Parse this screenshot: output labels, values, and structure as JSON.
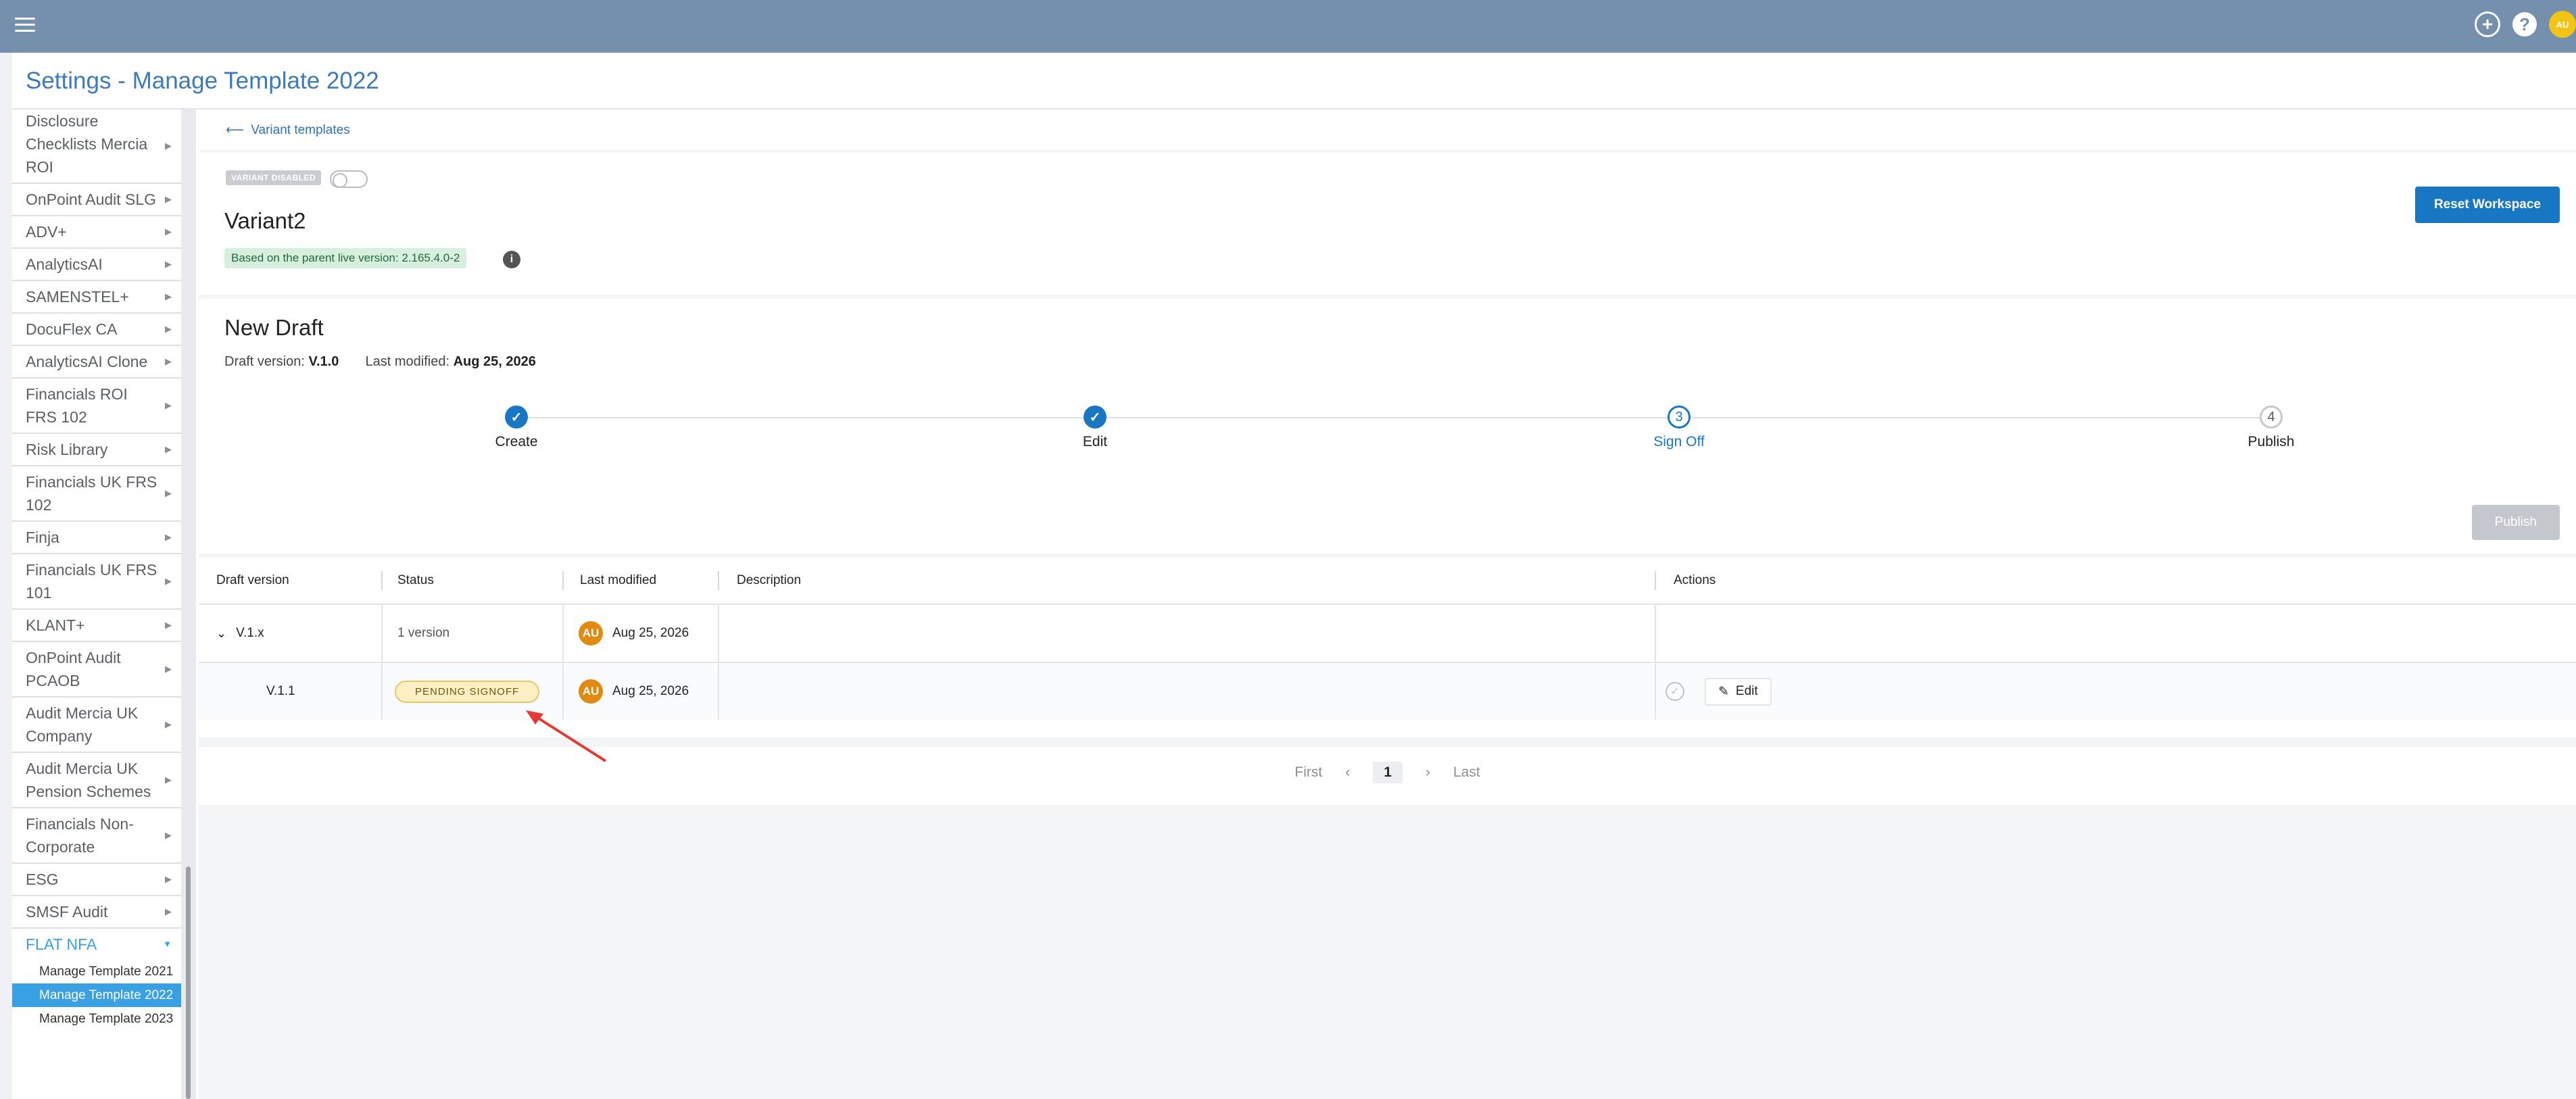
{
  "header": {
    "menu_icon": "hamburger-icon",
    "add_icon": "+",
    "help_icon": "?",
    "avatar_initials": "AU"
  },
  "page": {
    "title": "Settings - Manage Template 2022"
  },
  "sidebar": {
    "items": [
      {
        "label": "Disclosure Checklists Mercia ROI"
      },
      {
        "label": "OnPoint Audit SLG"
      },
      {
        "label": "ADV+"
      },
      {
        "label": "AnalyticsAI"
      },
      {
        "label": "SAMENSTEL+"
      },
      {
        "label": "DocuFlex CA"
      },
      {
        "label": "AnalyticsAI Clone"
      },
      {
        "label": "Financials ROI FRS 102"
      },
      {
        "label": "Risk Library"
      },
      {
        "label": "Financials UK FRS 102"
      },
      {
        "label": "Finja"
      },
      {
        "label": "Financials UK FRS 101"
      },
      {
        "label": "KLANT+"
      },
      {
        "label": "OnPoint Audit PCAOB"
      },
      {
        "label": "Audit Mercia UK Company"
      },
      {
        "label": "Audit Mercia UK Pension Schemes"
      },
      {
        "label": "Financials Non-Corporate"
      },
      {
        "label": "ESG"
      },
      {
        "label": "SMSF Audit"
      }
    ],
    "open_item": "FLAT NFA",
    "sub_items": [
      "Manage Template 2021",
      "Manage Template 2022",
      "Manage Template 2023"
    ],
    "active_sub_item": "Manage Template 2022"
  },
  "breadcrumb": {
    "back_label": "Variant templates"
  },
  "variant": {
    "status_badge": "VARIANT DISABLED",
    "name": "Variant2",
    "based_on": "Based on the parent live version: 2.165.4.0-2",
    "reset_button": "Reset Workspace"
  },
  "draft": {
    "title": "New Draft",
    "version_label": "Draft version:",
    "version_value": "V.1.0",
    "modified_label": "Last modified:",
    "modified_value": "Aug 25, 2026",
    "steps": [
      {
        "number": "✓",
        "label": "Create",
        "state": "done"
      },
      {
        "number": "✓",
        "label": "Edit",
        "state": "done"
      },
      {
        "number": "3",
        "label": "Sign Off",
        "state": "current"
      },
      {
        "number": "4",
        "label": "Publish",
        "state": "todo"
      }
    ],
    "publish_button": "Publish"
  },
  "table": {
    "headers": [
      "Draft version",
      "Status",
      "Last modified",
      "Description",
      "Actions"
    ],
    "group_row": {
      "version": "V.1.x",
      "status": "1 version",
      "avatar": "AU",
      "modified": "Aug 25, 2026",
      "description": ""
    },
    "child_row": {
      "version": "V.1.1",
      "status": "PENDING SIGNOFF",
      "avatar": "AU",
      "modified": "Aug 25, 2026",
      "description": "",
      "edit_label": "Edit"
    }
  },
  "pagination": {
    "first": "First",
    "current": "1",
    "last": "Last"
  },
  "colors": {
    "topbar": "#7590ac",
    "accent": "#1877c2",
    "active_sub": "#3aa0e4",
    "pending_bg": "#fdf0c4",
    "avatar": "#e08a12",
    "annotation_arrow": "#e53935"
  }
}
